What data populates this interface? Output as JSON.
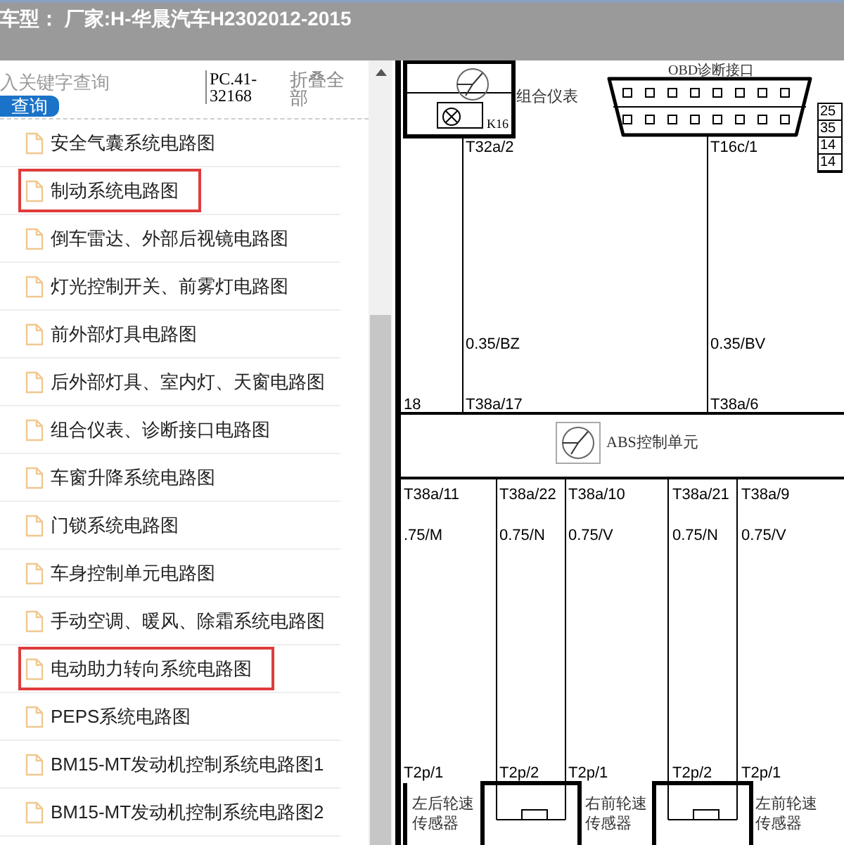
{
  "title": "车型： 厂家:H-华晨汽车H2302012-2015",
  "search": {
    "placeholder": "入关键字查询",
    "button": "查询"
  },
  "part_code": "PC.41-32168",
  "collapse_all": "折叠全部",
  "items": [
    {
      "label": "安全气囊系统电路图",
      "highlighted": false
    },
    {
      "label": "制动系统电路图",
      "highlighted": true
    },
    {
      "label": "倒车雷达、外部后视镜电路图",
      "highlighted": false
    },
    {
      "label": "灯光控制开关、前雾灯电路图",
      "highlighted": false
    },
    {
      "label": "前外部灯具电路图",
      "highlighted": false
    },
    {
      "label": "后外部灯具、室内灯、天窗电路图",
      "highlighted": false
    },
    {
      "label": "组合仪表、诊断接口电路图",
      "highlighted": false
    },
    {
      "label": "车窗升降系统电路图",
      "highlighted": false
    },
    {
      "label": "门锁系统电路图",
      "highlighted": false
    },
    {
      "label": "车身控制单元电路图",
      "highlighted": false
    },
    {
      "label": "手动空调、暖风、除霜系统电路图",
      "highlighted": false
    },
    {
      "label": "电动助力转向系统电路图",
      "highlighted": true
    },
    {
      "label": "PEPS系统电路图",
      "highlighted": false
    },
    {
      "label": "BM15-MT发动机控制系统电路图1",
      "highlighted": false
    },
    {
      "label": "BM15-MT发动机控制系统电路图2",
      "highlighted": false
    }
  ],
  "diagram": {
    "cluster_label": "组合仪表",
    "cluster_code": "K16",
    "obd_label": "OBD诊断接口",
    "table_cells": [
      "25",
      "35",
      "14",
      "14"
    ],
    "abs_label": "ABS控制单元",
    "labels": [
      "T32a/2",
      "T16c/1",
      "0.35/BZ",
      "0.35/BV",
      "18",
      "T38a/17",
      "T38a/6",
      "T38a/11",
      "T38a/22",
      "T38a/10",
      "T38a/21",
      "T38a/9",
      ".75/M",
      "0.75/N",
      "0.75/V",
      "0.75/N",
      "0.75/V",
      "T2p/1",
      "T2p/2",
      "T2p/1",
      "T2p/2",
      "T2p/1"
    ],
    "sensors": [
      "左后轮速传感器",
      "右前轮速传感器",
      "左前轮速传感器"
    ]
  }
}
